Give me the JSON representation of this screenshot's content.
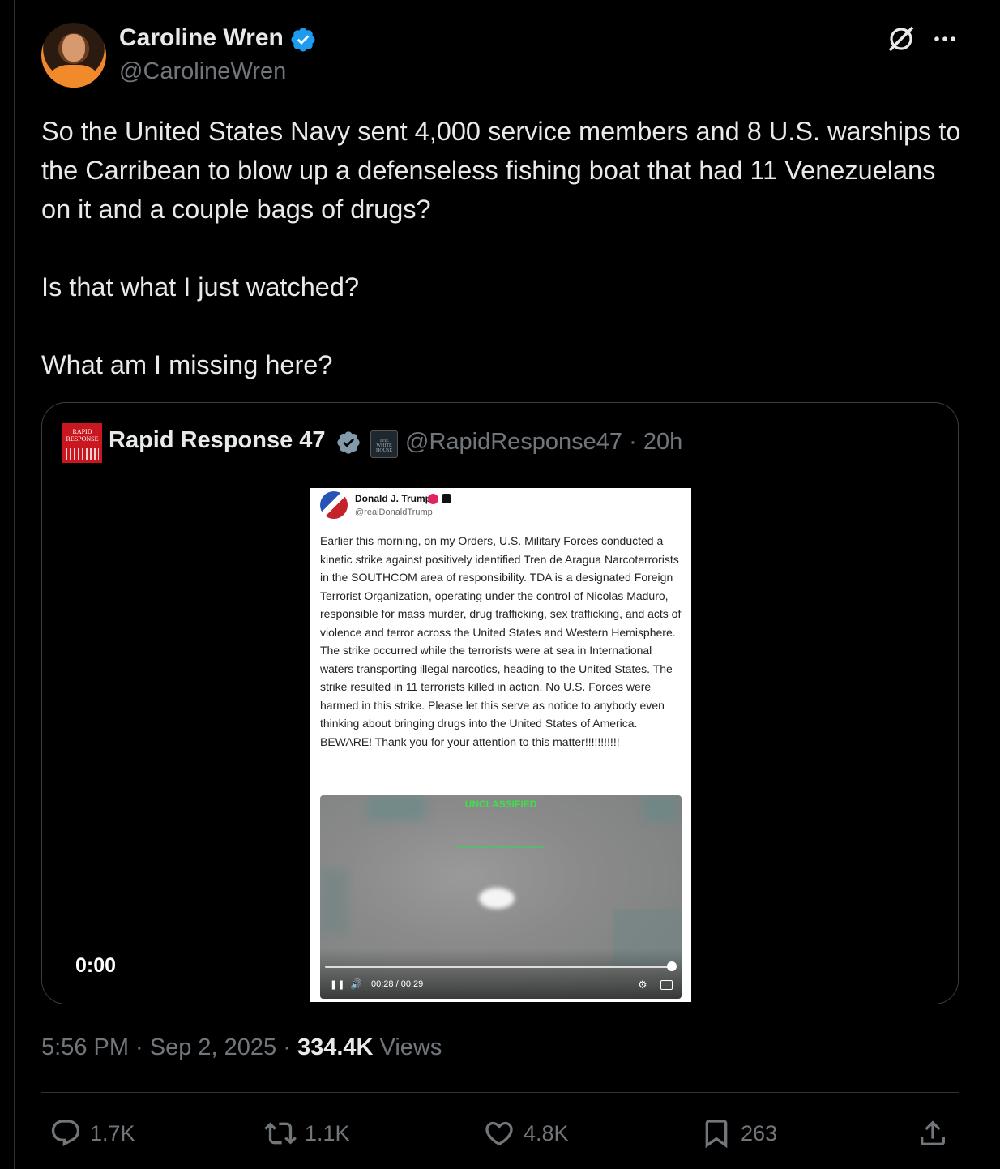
{
  "author": {
    "name": "Caroline Wren",
    "handle": "@CarolineWren",
    "verified": true
  },
  "tweet": {
    "paragraphs": [
      "So the United States Navy sent 4,000 service members and 8 U.S. warships to the Carribean to blow up a defenseless fishing boat that had 11 Venezuelans on it and a couple bags of drugs?",
      "Is that what I just watched?",
      "What am I missing here?"
    ]
  },
  "quote": {
    "avatar_text": "RAPID RESPONSE",
    "affiliate_badge_text": "THE WHITE HOUSE",
    "name": "Rapid Response 47",
    "handle_time": "@RapidResponse47 · 20h",
    "video_time": "0:00",
    "embedded_post": {
      "name": "Donald J. Trump",
      "handle": "@realDonaldTrump",
      "body": "Earlier this morning, on my Orders, U.S. Military Forces conducted a kinetic strike against positively identified Tren de Aragua Narcoterrorists in the SOUTHCOM area of responsibility. TDA is a designated Foreign Terrorist Organization, operating under the control of Nicolas Maduro, responsible for mass murder, drug trafficking, sex trafficking, and acts of violence and terror across the United States and Western Hemisphere. The strike occurred while the terrorists were at sea in International waters transporting illegal narcotics, heading to the United States. The strike resulted in 11 terrorists killed in action. No U.S. Forces were harmed in this strike. Please let this serve as notice to anybody even thinking about bringing drugs into the United States of America. BEWARE! Thank you for your attention to this matter!!!!!!!!!!!",
      "video_overlay": "UNCLASSIFIED",
      "video_time": "00:28 / 00:29",
      "video_progress_fraction": 0.97
    }
  },
  "meta": {
    "time_date": "5:56 PM · Sep 2, 2025 · ",
    "views_count": "334.4K",
    "views_label": " Views"
  },
  "actions": {
    "replies": "1.7K",
    "reposts": "1.1K",
    "likes": "4.8K",
    "bookmarks": "263"
  },
  "colors": {
    "background": "#000000",
    "text": "#e7e9ea",
    "muted": "#71767b",
    "verified": "#1d9bf0",
    "border": "#2f3336"
  },
  "icons": [
    "verified-badge-icon",
    "grok-icon",
    "more-icon",
    "reply-icon",
    "repost-icon",
    "like-icon",
    "bookmark-icon",
    "share-icon"
  ]
}
